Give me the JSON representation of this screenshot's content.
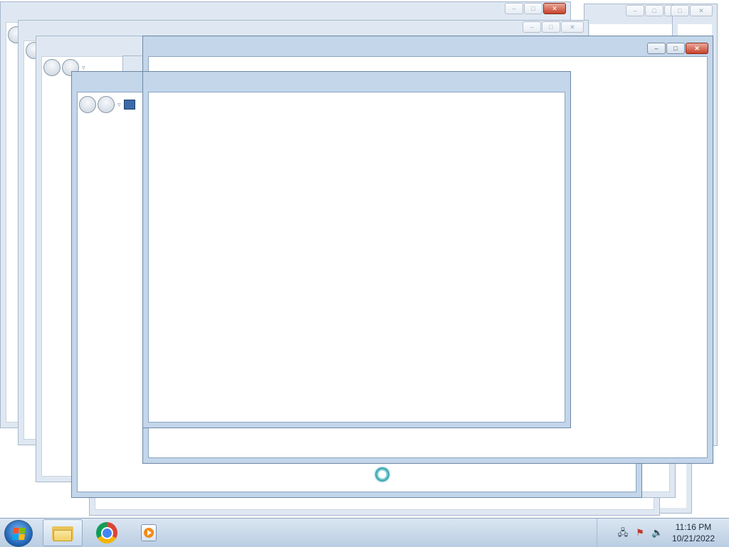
{
  "screen": {
    "description_free": true
  },
  "windows": {
    "caption_buttons": {
      "minimize": "–",
      "restore": "□",
      "close": "✕"
    },
    "nav": {
      "dropdown_arrow": "▿"
    }
  },
  "taskbar": {
    "start_icon": "windows-start-orb",
    "pinned": [
      {
        "name": "file-explorer-icon"
      },
      {
        "name": "chrome-icon"
      },
      {
        "name": "windows-media-player-icon"
      }
    ],
    "tray": {
      "icons": [
        "network-icon",
        "action-center-flag-icon",
        "volume-icon"
      ],
      "network_glyph": "🖧",
      "flag_glyph": "⚑",
      "volume_glyph": "🔈"
    },
    "clock": {
      "time": "11:16 PM",
      "date": "10/21/2022"
    }
  }
}
